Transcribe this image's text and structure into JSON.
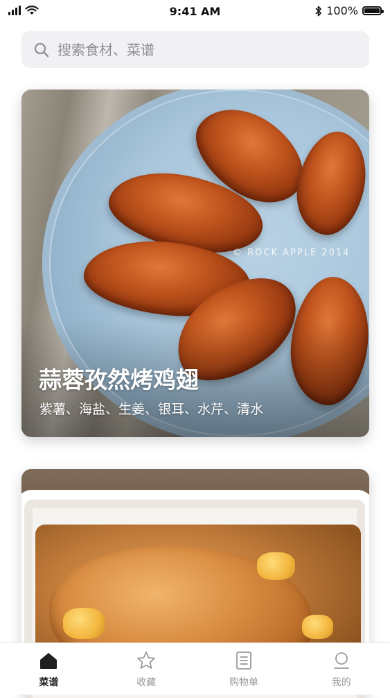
{
  "status_bar": {
    "time": "9:41 AM",
    "battery": "100%",
    "battery_level": 1.0
  },
  "search": {
    "placeholder": "搜索食材、菜谱"
  },
  "recipes": [
    {
      "title": "蒜蓉孜然烤鸡翅",
      "ingredients": "紫薯、海盐、生姜、银耳、水芹、清水",
      "watermark": "© ROCK APPLE  2014"
    }
  ],
  "tabs": [
    {
      "label": "菜谱",
      "icon": "home-icon",
      "active": true
    },
    {
      "label": "收藏",
      "icon": "star-icon",
      "active": false
    },
    {
      "label": "购物单",
      "icon": "list-icon",
      "active": false
    },
    {
      "label": "我的",
      "icon": "person-icon",
      "active": false
    }
  ],
  "colors": {
    "accent": "#1f1f1f",
    "inactive": "#9a9a9e",
    "search_bg": "#f1f1f3"
  }
}
